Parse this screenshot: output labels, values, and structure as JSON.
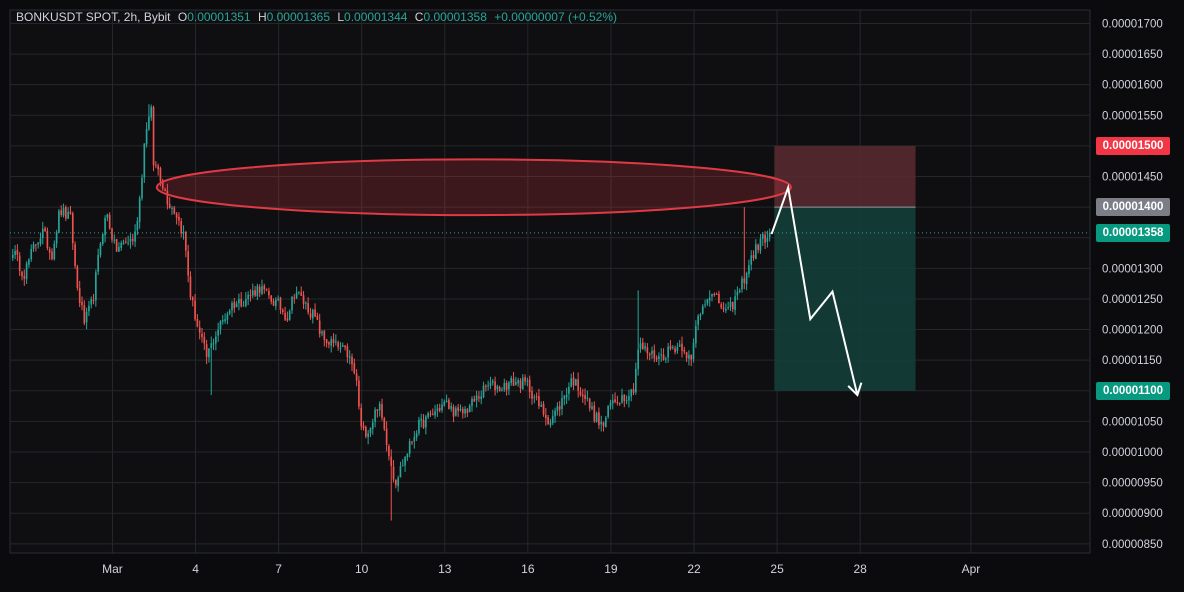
{
  "legend": {
    "symbol": "BONKUSDT SPOT, 2h, Bybit",
    "o_key": "O",
    "o": "0.00001351",
    "h_key": "H",
    "h": "0.00001365",
    "l_key": "L",
    "l": "0.00001344",
    "c_key": "C",
    "c": "0.00001358",
    "change": "+0.00000007 (+0.52%)"
  },
  "colors": {
    "up": "#26a69a",
    "down": "#ef5350",
    "background": "#0b0b0d",
    "grid": "#26272b",
    "axis_text": "#d1d4dc",
    "stop_zone": "#5b2a30",
    "target_zone": "#14413c",
    "ellipse": "#e03a45",
    "arrow": "#ffffff"
  },
  "price_tags": [
    {
      "label": "0.00001500",
      "price": 1500,
      "color": "#f23645"
    },
    {
      "label": "0.00001400",
      "price": 1400,
      "color": "#7b7e86"
    },
    {
      "label": "0.00001358",
      "price": 1358,
      "color": "#089981"
    },
    {
      "label": "0.00001100",
      "price": 1100,
      "color": "#089981"
    }
  ],
  "chart_data": {
    "type": "candlestick",
    "unit": "price in 1e-8 USDT",
    "y_ticks": [
      "0.00001700",
      "0.00001650",
      "0.00001600",
      "0.00001550",
      "0.00001500",
      "0.00001450",
      "0.00001400",
      "0.00001350",
      "0.00001300",
      "0.00001250",
      "0.00001200",
      "0.00001150",
      "0.00001100",
      "0.00001050",
      "0.00001000",
      "0.00000950",
      "0.00000900",
      "0.00000850"
    ],
    "y_tick_values": [
      1700,
      1650,
      1600,
      1550,
      1500,
      1450,
      1400,
      1350,
      1300,
      1250,
      1200,
      1150,
      1100,
      1050,
      1000,
      950,
      900,
      850
    ],
    "ylim": [
      835,
      1722
    ],
    "x_labels": [
      "Mar",
      "4",
      "7",
      "10",
      "13",
      "16",
      "19",
      "22",
      "25",
      "28",
      "Apr"
    ],
    "x_label_days": [
      1,
      4,
      7,
      10,
      13,
      16,
      19,
      22,
      25,
      28,
      32
    ],
    "xlim_days": [
      -2.7,
      36.3
    ],
    "candles_per_day": 12,
    "first_candle_day": -2.6,
    "anchors": [
      [
        -2.6,
        1330
      ],
      [
        -2.2,
        1290
      ],
      [
        -1.8,
        1340
      ],
      [
        -1.5,
        1360
      ],
      [
        -1.2,
        1320
      ],
      [
        -0.9,
        1395
      ],
      [
        -0.5,
        1380
      ],
      [
        -0.3,
        1275
      ],
      [
        0,
        1210
      ],
      [
        0.3,
        1250
      ],
      [
        0.6,
        1355
      ],
      [
        0.8,
        1390
      ],
      [
        1.1,
        1330
      ],
      [
        1.4,
        1340
      ],
      [
        1.8,
        1350
      ],
      [
        2.0,
        1420
      ],
      [
        2.2,
        1530
      ],
      [
        2.4,
        1555
      ],
      [
        2.5,
        1455
      ],
      [
        2.6,
        1470
      ],
      [
        2.8,
        1440
      ],
      [
        3.0,
        1410
      ],
      [
        3.3,
        1390
      ],
      [
        3.6,
        1350
      ],
      [
        3.8,
        1260
      ],
      [
        4.1,
        1200
      ],
      [
        4.4,
        1155
      ],
      [
        4.8,
        1200
      ],
      [
        5.3,
        1240
      ],
      [
        5.8,
        1250
      ],
      [
        6.3,
        1270
      ],
      [
        6.7,
        1250
      ],
      [
        7.0,
        1240
      ],
      [
        7.3,
        1220
      ],
      [
        7.6,
        1265
      ],
      [
        7.9,
        1245
      ],
      [
        8.3,
        1220
      ],
      [
        8.6,
        1185
      ],
      [
        9.0,
        1175
      ],
      [
        9.5,
        1160
      ],
      [
        9.8,
        1120
      ],
      [
        10.0,
        1030
      ],
      [
        10.3,
        1040
      ],
      [
        10.6,
        1080
      ],
      [
        10.9,
        1020
      ],
      [
        11.2,
        950
      ],
      [
        11.6,
        995
      ],
      [
        12.0,
        1040
      ],
      [
        12.5,
        1060
      ],
      [
        13.0,
        1080
      ],
      [
        13.5,
        1060
      ],
      [
        13.8,
        1070
      ],
      [
        14.2,
        1090
      ],
      [
        14.6,
        1110
      ],
      [
        15.0,
        1105
      ],
      [
        15.5,
        1115
      ],
      [
        16.0,
        1110
      ],
      [
        16.4,
        1075
      ],
      [
        16.8,
        1050
      ],
      [
        17.2,
        1080
      ],
      [
        17.6,
        1120
      ],
      [
        18.0,
        1095
      ],
      [
        18.4,
        1060
      ],
      [
        18.7,
        1040
      ],
      [
        19.0,
        1080
      ],
      [
        19.4,
        1090
      ],
      [
        19.8,
        1100
      ],
      [
        20.0,
        1175
      ],
      [
        20.4,
        1160
      ],
      [
        20.8,
        1155
      ],
      [
        21.2,
        1170
      ],
      [
        21.6,
        1175
      ],
      [
        21.9,
        1145
      ],
      [
        22.1,
        1215
      ],
      [
        22.5,
        1260
      ],
      [
        22.9,
        1245
      ],
      [
        23.2,
        1225
      ],
      [
        23.6,
        1260
      ],
      [
        23.9,
        1295
      ],
      [
        24.1,
        1320
      ],
      [
        24.4,
        1345
      ],
      [
        24.8,
        1358
      ]
    ],
    "spikes": [
      {
        "day": 2.3,
        "high": 1568
      },
      {
        "day": 4.6,
        "low": 1093
      },
      {
        "day": 11.1,
        "low": 888
      },
      {
        "day": 20.0,
        "high": 1264
      },
      {
        "day": 23.8,
        "high": 1400
      }
    ],
    "last": {
      "open": 1351,
      "high": 1365,
      "low": 1344,
      "close": 1358
    },
    "drawings": {
      "ellipse": {
        "day_left": 2.6,
        "day_right": 25.5,
        "price_top": 1478,
        "price_bottom": 1387
      },
      "stop_zone": {
        "day_from": 24.9,
        "day_to": 30.0,
        "price_from": 1400,
        "price_to": 1500
      },
      "target_zone": {
        "day_from": 24.9,
        "day_to": 30.0,
        "price_from": 1100,
        "price_to": 1400
      },
      "path": [
        [
          24.8,
          1356
        ],
        [
          25.4,
          1432
        ],
        [
          26.2,
          1217
        ],
        [
          27.0,
          1262
        ],
        [
          27.9,
          1093
        ]
      ]
    }
  }
}
